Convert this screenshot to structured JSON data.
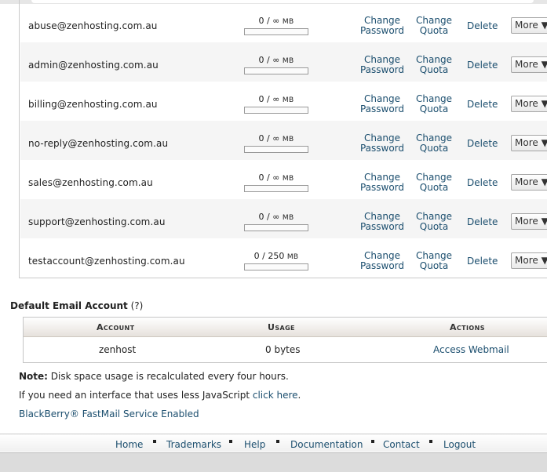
{
  "accounts": [
    {
      "email": "abuse@zenhosting.com.au",
      "used": "0",
      "quota": "∞",
      "unit": "MB",
      "usage_fraction": 0
    },
    {
      "email": "admin@zenhosting.com.au",
      "used": "0",
      "quota": "∞",
      "unit": "MB",
      "usage_fraction": 0
    },
    {
      "email": "billing@zenhosting.com.au",
      "used": "0",
      "quota": "∞",
      "unit": "MB",
      "usage_fraction": 0
    },
    {
      "email": "no-reply@zenhosting.com.au",
      "used": "0",
      "quota": "∞",
      "unit": "MB",
      "usage_fraction": 0
    },
    {
      "email": "sales@zenhosting.com.au",
      "used": "0",
      "quota": "∞",
      "unit": "MB",
      "usage_fraction": 0
    },
    {
      "email": "support@zenhosting.com.au",
      "used": "0",
      "quota": "∞",
      "unit": "MB",
      "usage_fraction": 0
    },
    {
      "email": "testaccount@zenhosting.com.au",
      "used": "0",
      "quota": "250",
      "unit": "MB",
      "usage_fraction": 0
    }
  ],
  "row_actions": {
    "change": "Change",
    "password": "Password",
    "quota": "Quota",
    "delete": "Delete",
    "more": "More ▼"
  },
  "default_account": {
    "title": "Default Email Account",
    "help": "(?)",
    "headers": {
      "account": "Account",
      "usage": "Usage",
      "actions": "Actions"
    },
    "account": "zenhost",
    "usage": "0 bytes",
    "action": "Access Webmail"
  },
  "notes": {
    "note_label": "Note:",
    "note_text": " Disk space usage is recalculated every four hours.",
    "js_text": "If you need an interface that uses less JavaScript ",
    "js_link": "click here",
    "js_end": ".",
    "blackberry": "BlackBerry® FastMail Service Enabled"
  },
  "footer": [
    "Home",
    "Trademarks",
    "Help",
    "Documentation",
    "Contact",
    "Logout"
  ],
  "colors": {
    "link": "#1b4e6e",
    "row_alt": "#f5f5f5"
  }
}
